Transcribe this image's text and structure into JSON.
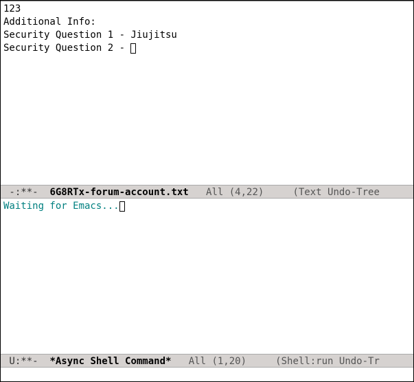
{
  "top_buffer": {
    "lines": [
      "123",
      "Additional Info:",
      "Security Question 1 - Jiujitsu",
      "Security Question 2 - "
    ]
  },
  "top_modeline": {
    "prefix": " -:**-  ",
    "buffername": "6G8RTx-forum-account.txt",
    "position": "   All (4,22)     ",
    "modes": "(Text Undo-Tree"
  },
  "bottom_buffer": {
    "prompt": "Waiting for Emacs..."
  },
  "bottom_modeline": {
    "prefix": " U:**-  ",
    "buffername": "*Async Shell Command*",
    "position": "   All (1,20)     ",
    "modes": "(Shell:run Undo-Tr"
  },
  "minibuffer": {
    "text": ""
  }
}
